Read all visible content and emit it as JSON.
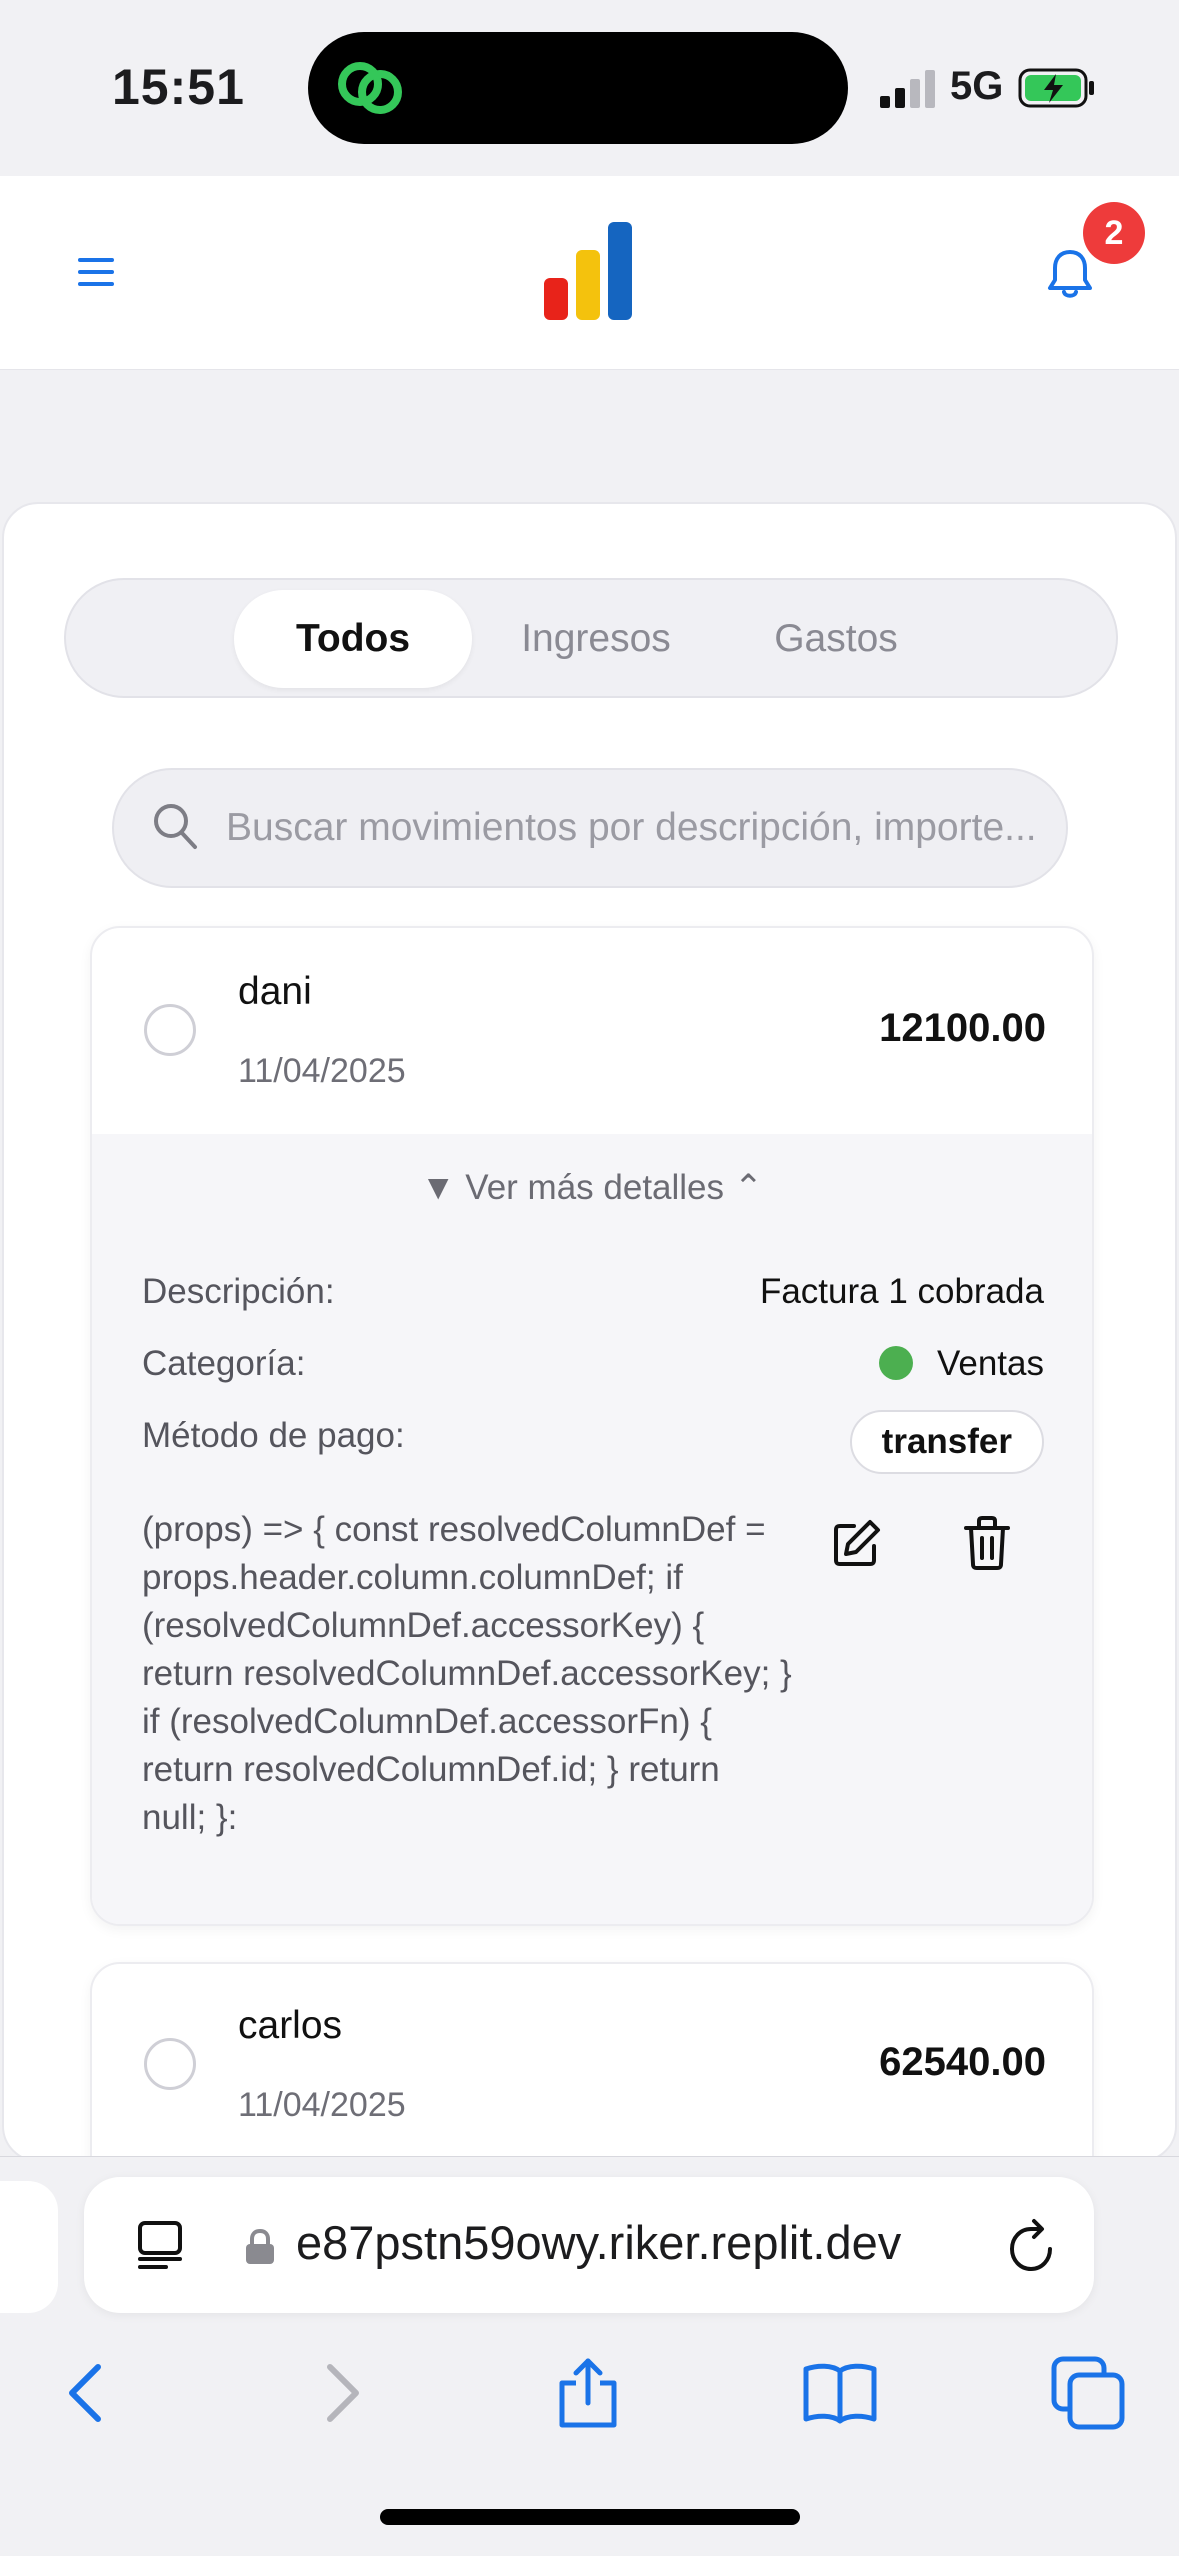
{
  "status_bar": {
    "time": "15:51",
    "network": "5G",
    "icons": [
      "link-activity-icon",
      "signal-icon",
      "battery-charging-icon"
    ]
  },
  "header": {
    "menu_icon": "menu-icon",
    "logo": "bar-chart-logo",
    "notification_count": "2"
  },
  "tabs": [
    {
      "label": "Todos",
      "active": true
    },
    {
      "label": "Ingresos",
      "active": false
    },
    {
      "label": "Gastos",
      "active": false
    }
  ],
  "search": {
    "placeholder": "Buscar movimientos por descripción, importe..."
  },
  "movements": [
    {
      "name": "dani",
      "date": "11/04/2025",
      "amount": "12100.00",
      "details_toggle": "▼ Ver más detalles ⌃",
      "details": {
        "description_label": "Descripción:",
        "description_value": "Factura 1 cobrada",
        "category_label": "Categoría:",
        "category_value": "Ventas",
        "category_color": "#4caf50",
        "payment_label": "Método de pago:",
        "payment_value": "transfer",
        "extra_text": "(props) => { const resolvedColumnDef = props.header.column.columnDef; if (resolvedColumnDef.accessorKey) { return resolvedColumnDef.accessorKey; } if (resolvedColumnDef.accessorFn) { return resolvedColumnDef.id; } return null; }:"
      }
    },
    {
      "name": "carlos",
      "date": "11/04/2025",
      "amount": "62540.00"
    }
  ],
  "browser": {
    "url": "e87pstn59owy.riker.replit.dev"
  },
  "colors": {
    "accent": "#1a73e8",
    "logo_red": "#e8231a",
    "logo_yellow": "#f4c20d",
    "logo_blue": "#1565c0",
    "badge": "#ee3b3b"
  }
}
